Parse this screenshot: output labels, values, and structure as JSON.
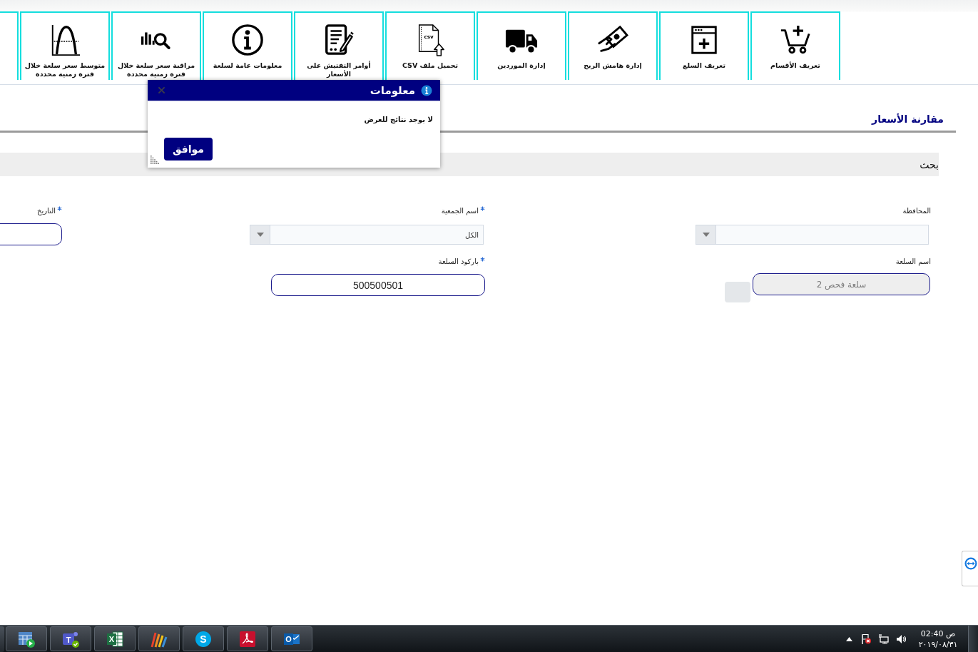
{
  "toolbar": {
    "more_left": true,
    "items": [
      {
        "label": "تعريف الأقسام"
      },
      {
        "label": "تعريف السلع"
      },
      {
        "label": "إدارة هامش الربح"
      },
      {
        "label": "إدارة الموردين"
      },
      {
        "label": "تحميل ملف CSV",
        "icon_text": "csv"
      },
      {
        "label": "أوامر التفتيش على الأسعار"
      },
      {
        "label": "معلومات عامة لسلعة"
      },
      {
        "label": "مراقبة سعر سلعة خلال فترة زمنية محددة"
      },
      {
        "label": "متوسط سعر سلعة خلال فترة زمنية محددة"
      }
    ]
  },
  "page": {
    "title": "مقارنة الأسعار"
  },
  "search": {
    "title": "بحث",
    "columns": [
      {
        "fields": [
          {
            "kind": "select",
            "label": "المحافظة",
            "required": false
          },
          {
            "kind": "lookup",
            "label": "اسم السلعة",
            "required": false,
            "value": "سلعة فحص 2",
            "disabled": true
          }
        ]
      },
      {
        "fields": [
          {
            "kind": "select",
            "label": "اسم الجمعية",
            "required": true,
            "value": "الكل"
          },
          {
            "kind": "text",
            "label": "باركود السلعة",
            "required": true,
            "value": "500500501",
            "disabled": false
          }
        ]
      },
      {
        "fields": [
          {
            "kind": "text",
            "label": "التاريخ",
            "required": true,
            "disabled": false
          }
        ]
      }
    ]
  },
  "dialog": {
    "title": "معلومات",
    "message": "لا يوجد نتائج للعرض",
    "button": "موافق"
  },
  "taskbar": {
    "apps": [
      {
        "kind": "mail",
        "letter": "O"
      },
      {
        "kind": "pdf"
      },
      {
        "kind": "call",
        "letter": "S"
      },
      {
        "kind": "stripes"
      },
      {
        "kind": "sheet",
        "letter": "X"
      },
      {
        "kind": "chat",
        "letter": "T"
      },
      {
        "kind": "media"
      }
    ],
    "clock": {
      "time": "02:40 ص",
      "date": "٢٠١٩/٠٨/٣١"
    }
  }
}
